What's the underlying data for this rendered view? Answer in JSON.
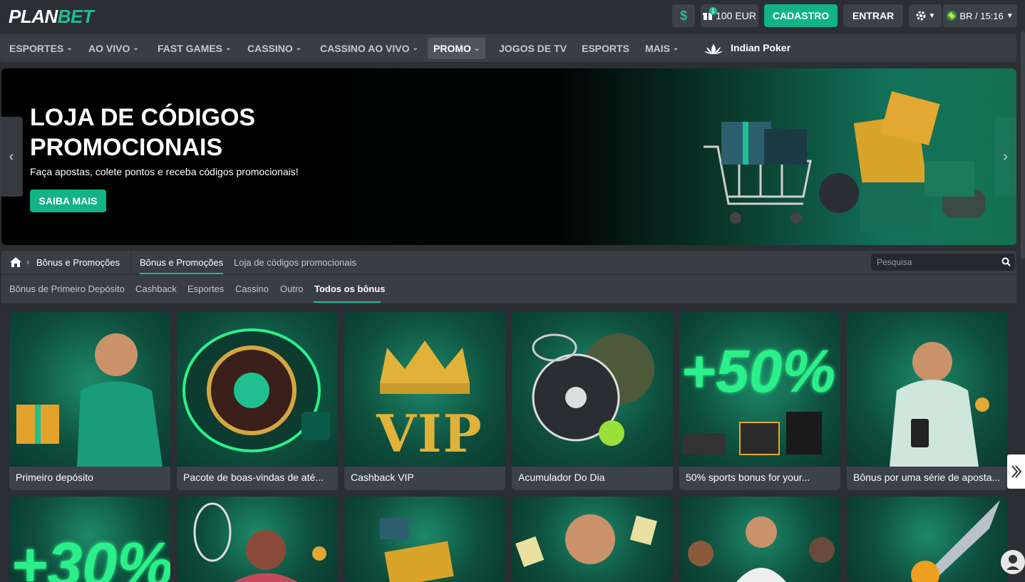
{
  "header": {
    "logo_plan": "PLAN",
    "logo_bet": "BET",
    "dollar_icon": "$",
    "gift_badge": "1",
    "gift_amount": "100 EUR",
    "register": "CADASTRO",
    "login": "ENTRAR",
    "lang_time": "BR / 15:16"
  },
  "nav": {
    "items": [
      {
        "label": "ESPORTES"
      },
      {
        "label": "AO VIVO"
      },
      {
        "label": "FAST GAMES"
      },
      {
        "label": "CASSINO"
      },
      {
        "label": "CASSINO AO VIVO"
      },
      {
        "label": "PROMO"
      },
      {
        "label": "JOGOS DE TV"
      },
      {
        "label": "ESPORTS"
      },
      {
        "label": "MAIS"
      }
    ],
    "indian_poker": "Indian Poker"
  },
  "banner": {
    "title_line1": "LOJA DE CÓDIGOS",
    "title_line2": "PROMOCIONAIS",
    "subtitle": "Faça apostas, colete pontos e receba códigos promocionais!",
    "button": "SAIBA MAIS"
  },
  "breadcrumb": {
    "root": "Bônus e Promoções",
    "tab1": "Bônus e Promoções",
    "tab2": "Loja de códigos promocionais",
    "search_placeholder": "Pesquisa"
  },
  "filters": [
    "Bônus de Primeiro Depósito",
    "Cashback",
    "Esportes",
    "Cassino",
    "Outro",
    "Todos os bônus"
  ],
  "cards": [
    {
      "label": "Primeiro depósito"
    },
    {
      "label": "Pacote de boas-vindas de até..."
    },
    {
      "label": "Cashback VIP"
    },
    {
      "label": "Acumulador Do Dia"
    },
    {
      "label": "50% sports bonus for your..."
    },
    {
      "label": "Bônus por uma série de aposta..."
    }
  ],
  "card_art": {
    "vip": "VIP",
    "pct50": "+50%",
    "pct30": "+30%"
  }
}
